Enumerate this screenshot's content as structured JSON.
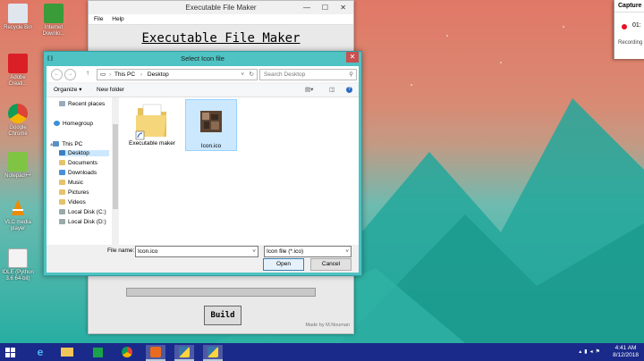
{
  "desktop_icons": [
    {
      "label": "Recycle Bin",
      "color": "#dfe6ee"
    },
    {
      "label": "Internet Downlo...",
      "color": "#3a9b39"
    },
    {
      "label": "Adobe Creati...",
      "color": "#da1f26"
    },
    {
      "label": "Google Chrome",
      "color": "#f0c419"
    },
    {
      "label": "Notepad++",
      "color": "#7fc543"
    },
    {
      "label": "VLC media player",
      "color": "#f08a00"
    },
    {
      "label": "IDLE (Python 3.6 64-bit)",
      "color": "#f3f3f3"
    }
  ],
  "efm_window": {
    "title": "Executable File Maker",
    "menu": [
      "File",
      "Help"
    ],
    "heading": "Executable File Maker",
    "build_label": "Build",
    "credit": "Made by M.Nouman"
  },
  "capture_panel": {
    "title": "Capture",
    "time": "01:",
    "status": "Recording"
  },
  "dialog": {
    "title": "Select Icon file",
    "address": [
      "This PC",
      "Desktop"
    ],
    "search_placeholder": "Search Desktop",
    "organize_label": "Organize",
    "new_folder_label": "New folder",
    "tree": [
      {
        "label": "Recent places",
        "icon": "clock-icon",
        "indent": 1
      },
      {
        "label": "Homegroup",
        "icon": "homegroup-icon",
        "indent": 0
      },
      {
        "label": "This PC",
        "icon": "computer-icon",
        "indent": 0
      },
      {
        "label": "Desktop",
        "icon": "desktop-icon",
        "indent": 1,
        "selected": true
      },
      {
        "label": "Documents",
        "icon": "documents-icon",
        "indent": 1
      },
      {
        "label": "Downloads",
        "icon": "downloads-icon",
        "indent": 1
      },
      {
        "label": "Music",
        "icon": "music-icon",
        "indent": 1
      },
      {
        "label": "Pictures",
        "icon": "pictures-icon",
        "indent": 1
      },
      {
        "label": "Videos",
        "icon": "videos-icon",
        "indent": 1
      },
      {
        "label": "Local Disk (C:)",
        "icon": "drive-icon",
        "indent": 1
      },
      {
        "label": "Local Disk (D:)",
        "icon": "drive-icon",
        "indent": 1
      }
    ],
    "files": [
      {
        "label": "Executable maker",
        "icon": "folder-shortcut-icon"
      },
      {
        "label": "Icon.ico",
        "icon": "ico-file-icon",
        "selected": true
      }
    ],
    "file_name_label": "File name:",
    "file_name_value": "Icon.ico",
    "file_type_value": "Icon file (*.ico)",
    "open_label": "Open",
    "cancel_label": "Cancel"
  },
  "taskbar": {
    "apps": [
      "ie-icon",
      "file-explorer-icon",
      "store-icon",
      "chrome-icon",
      "orange-app-icon",
      "python-icon",
      "python-tk-icon"
    ],
    "time": "4:41 AM",
    "date": "8/12/2018"
  }
}
